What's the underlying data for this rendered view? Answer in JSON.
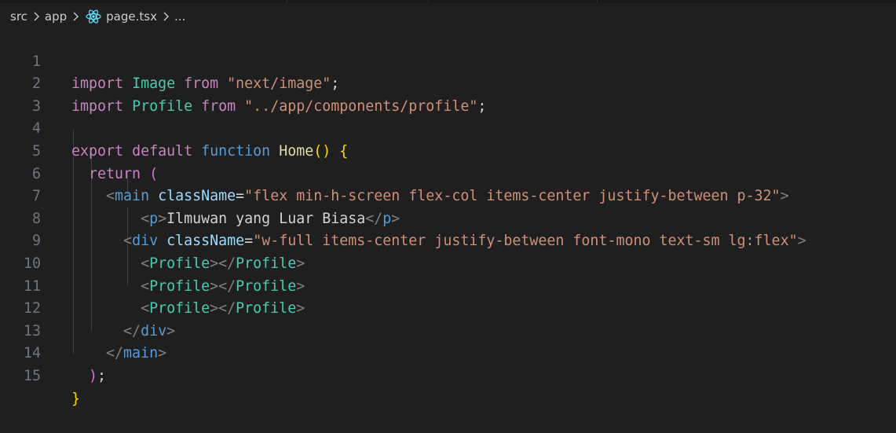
{
  "breadcrumb": {
    "items": [
      "src",
      "app",
      "page.tsx",
      "..."
    ]
  },
  "line_numbers": [
    "1",
    "2",
    "3",
    "4",
    "5",
    "6",
    "7",
    "8",
    "9",
    "10",
    "11",
    "12",
    "13",
    "14",
    "15"
  ],
  "code": {
    "l1": {
      "import_kw": "import",
      "name": "Image",
      "from_kw": "from",
      "module": "\"next/image\"",
      "semicolon": ";"
    },
    "l2": {
      "import_kw": "import",
      "name": "Profile",
      "from_kw": "from",
      "module": "\"../app/components/profile\"",
      "semicolon": ";"
    },
    "l4": {
      "export_kw": "export",
      "default_kw": "default",
      "function_kw": "function",
      "fn_name": "Home",
      "paren_open": "(",
      "paren_close": ")",
      "brace_open": "{"
    },
    "l5": {
      "return_kw": "return",
      "paren_open": "("
    },
    "l6": {
      "tag_open": "<",
      "tag": "main",
      "attr": "className",
      "eq": "=",
      "value": "\"flex min-h-screen flex-col items-center justify-between p-32\"",
      "tag_close": ">"
    },
    "l7": {
      "open_lt": "<",
      "open_tag": "p",
      "open_gt": ">",
      "text": "Ilmuwan yang Luar Biasa",
      "close_lt": "</",
      "close_tag": "p",
      "close_gt": ">"
    },
    "l8": {
      "tag_open": "<",
      "tag": "div",
      "attr": "className",
      "eq": "=",
      "value": "\"w-full items-center justify-between font-mono text-sm lg:flex\"",
      "tag_close": ">"
    },
    "profile_line": {
      "open_lt": "<",
      "component": "Profile",
      "open_gt": ">",
      "close_lt": "</",
      "close_gt": ">"
    },
    "l12": {
      "close_lt": "</",
      "tag": "div",
      "close_gt": ">"
    },
    "l13": {
      "close_lt": "</",
      "tag": "main",
      "close_gt": ">"
    },
    "l14": {
      "paren_close": ")",
      "semicolon": ";"
    },
    "l15": {
      "brace_close": "}"
    }
  },
  "colors": {
    "background": "#1f1f1f",
    "line_number": "#6e7681",
    "keyword_control": "#c586c0",
    "keyword_storage": "#569cd6",
    "string": "#ce9178",
    "function": "#dcdcaa",
    "component": "#4ec9b0",
    "attribute": "#9cdcfe",
    "punctuation": "#808080",
    "bracket_gold": "#ffd700",
    "bracket_orchid": "#da70d6",
    "text": "#d4d4d4"
  },
  "icons": {
    "breadcrumb_separator": "chevron-right-icon",
    "file_type": "react-icon"
  }
}
